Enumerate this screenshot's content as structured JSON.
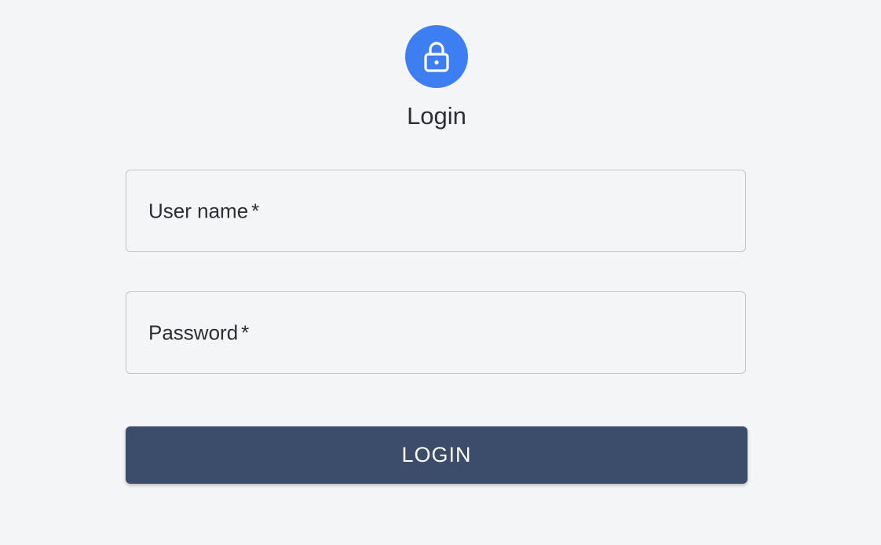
{
  "header": {
    "icon": "lock-icon",
    "icon_color": "#3d7ff2",
    "title": "Login"
  },
  "form": {
    "username": {
      "label": "User name",
      "required_mark": "*",
      "value": ""
    },
    "password": {
      "label": "Password",
      "required_mark": "*",
      "value": ""
    },
    "submit_label": "LOGIN",
    "submit_color": "#3b4d6b"
  }
}
